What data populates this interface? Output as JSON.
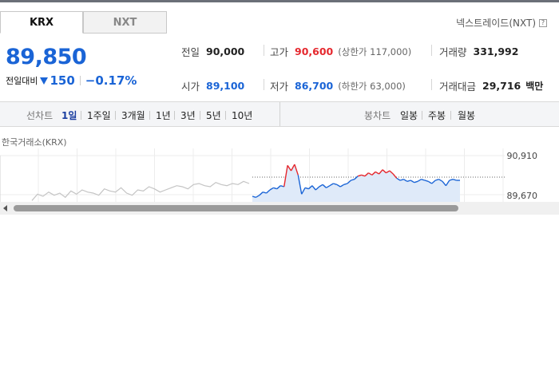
{
  "tabs": [
    {
      "label": "KRX",
      "active": true
    },
    {
      "label": "NXT",
      "active": false
    }
  ],
  "nxt_link": "넥스트레이드(NXT)",
  "price": {
    "current": "89,850",
    "change_label": "전일대비",
    "direction": "down",
    "change": "150",
    "change_pct": "−0.17%"
  },
  "stats": {
    "prev_close": {
      "label": "전일",
      "value": "90,000"
    },
    "high": {
      "label": "고가",
      "value": "90,600",
      "sub": "(상한가 117,000)"
    },
    "volume": {
      "label": "거래량",
      "value": "331,992"
    },
    "open": {
      "label": "시가",
      "value": "89,100"
    },
    "low": {
      "label": "저가",
      "value": "86,700",
      "sub": "(하한가 63,000)"
    },
    "trade_value": {
      "label": "거래대금",
      "value": "29,716",
      "unit": "백만"
    }
  },
  "periods": {
    "line_label": "선차트",
    "line_items": [
      "1일",
      "1주일",
      "3개월",
      "1년",
      "3년",
      "5년",
      "10년"
    ],
    "active": "1일",
    "candle_label": "봉차트",
    "candle_items": [
      "일봉",
      "주봉",
      "월봉"
    ]
  },
  "chart_source": "한국거래소(KRX)",
  "colors": {
    "up": "#e5282e",
    "down": "#1a64d6",
    "prev_day": "#c4c4c4"
  },
  "chart_data": {
    "type": "line",
    "y_ticks": [
      "90,910",
      "89,670"
    ],
    "ylim": [
      88800,
      91200
    ],
    "reference": 90000,
    "series": [
      {
        "values": [
          88900,
          89200,
          89100,
          89300,
          89150,
          89250,
          89050,
          89350,
          89200,
          89400,
          89300,
          89250,
          89150,
          89450,
          89350,
          89300,
          89500,
          89250,
          89150,
          89400,
          89350,
          89550,
          89450,
          89300,
          89400,
          89500,
          89600,
          89550,
          89450,
          89650,
          89700,
          89600,
          89550,
          89750,
          89650,
          89600,
          89700,
          89650,
          89800,
          89700
        ]
      },
      {
        "values": [
          89100,
          89050,
          89150,
          89300,
          89250,
          89400,
          89500,
          89450,
          89600,
          89550,
          90550,
          90300,
          90600,
          90100,
          89200,
          89500,
          89450,
          89600,
          89400,
          89550,
          89650,
          89500,
          89600,
          89700,
          89650,
          89550,
          89650,
          89700,
          89850,
          89900,
          90050,
          90100,
          90050,
          90200,
          90100,
          90250,
          90150,
          90350,
          90200,
          90300,
          90150,
          89950,
          89850,
          89900,
          89800,
          89850,
          89750,
          89800,
          89900,
          89850,
          89800,
          89700,
          89850,
          89900,
          89800,
          89600,
          89850,
          89900,
          89850,
          89850
        ]
      }
    ]
  }
}
